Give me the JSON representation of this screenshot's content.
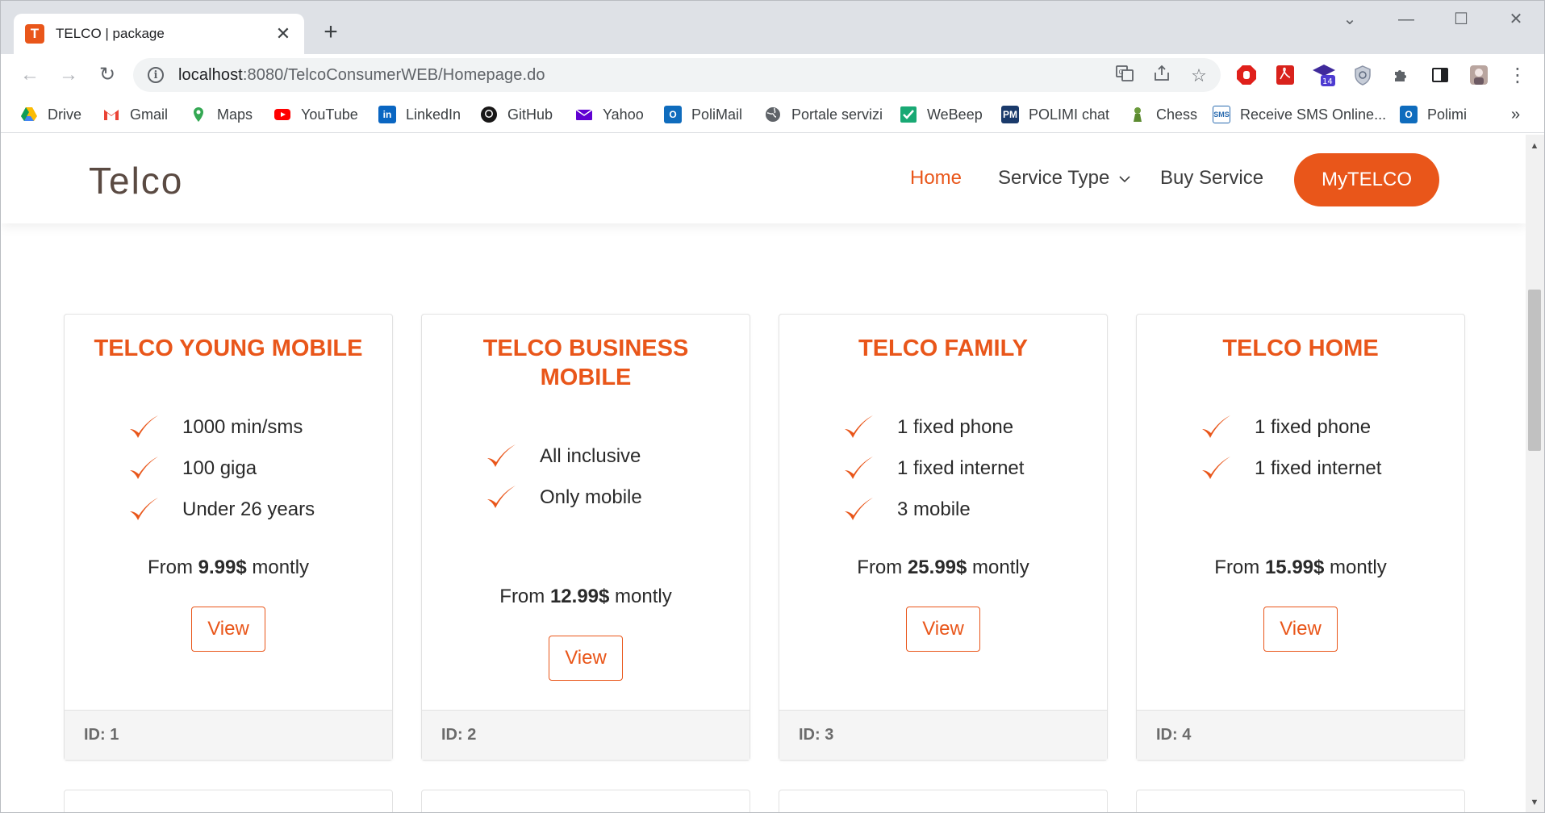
{
  "browser": {
    "tab_title": "TELCO | package",
    "tab_favicon_letter": "T",
    "url_host": "localhost",
    "url_rest": ":8080/TelcoConsumerWEB/Homepage.do",
    "extension_badge": "14",
    "bookmarks": [
      {
        "label": "Drive",
        "icon": "drive-icon"
      },
      {
        "label": "Gmail",
        "icon": "gmail-icon"
      },
      {
        "label": "Maps",
        "icon": "maps-icon"
      },
      {
        "label": "YouTube",
        "icon": "youtube-icon"
      },
      {
        "label": "LinkedIn",
        "icon": "linkedin-icon"
      },
      {
        "label": "GitHub",
        "icon": "github-icon"
      },
      {
        "label": "Yahoo",
        "icon": "yahoo-icon"
      },
      {
        "label": "PoliMail",
        "icon": "outlook-icon"
      },
      {
        "label": "Portale servizi",
        "icon": "globe-icon"
      },
      {
        "label": "WeBeep",
        "icon": "webeep-icon"
      },
      {
        "label": "POLIMI chat",
        "icon": "polimi-chat-icon"
      },
      {
        "label": "Chess",
        "icon": "chess-pawn-icon"
      },
      {
        "label": "Receive SMS Online...",
        "icon": "sms-icon"
      },
      {
        "label": "Polimi",
        "icon": "outlook-icon"
      }
    ],
    "bookmarks_overflow": "»"
  },
  "site": {
    "logo": "Telco",
    "nav": {
      "home": "Home",
      "service_type": "Service Type",
      "buy_service": "Buy Service",
      "mytelco": "MyTELCO"
    },
    "accent_color": "#e9561a"
  },
  "packages": [
    {
      "title": "TELCO YOUNG MOBILE",
      "features": [
        "1000 min/sms",
        "100 giga",
        "Under 26 years"
      ],
      "price_prefix": "From ",
      "price": "9.99$",
      "price_suffix": " montly",
      "button": "View",
      "id_label": "ID: 1"
    },
    {
      "title": "TELCO BUSINESS MOBILE",
      "features": [
        "All inclusive",
        "Only mobile"
      ],
      "price_prefix": "From ",
      "price": "12.99$",
      "price_suffix": " montly",
      "button": "View",
      "id_label": "ID: 2"
    },
    {
      "title": "TELCO FAMILY",
      "features": [
        "1 fixed phone",
        "1 fixed internet",
        "3 mobile"
      ],
      "price_prefix": "From ",
      "price": "25.99$",
      "price_suffix": " montly",
      "button": "View",
      "id_label": "ID: 3"
    },
    {
      "title": "TELCO HOME",
      "features": [
        "1 fixed phone",
        "1 fixed internet"
      ],
      "price_prefix": "From ",
      "price": "15.99$",
      "price_suffix": " montly",
      "button": "View",
      "id_label": "ID: 4"
    }
  ]
}
